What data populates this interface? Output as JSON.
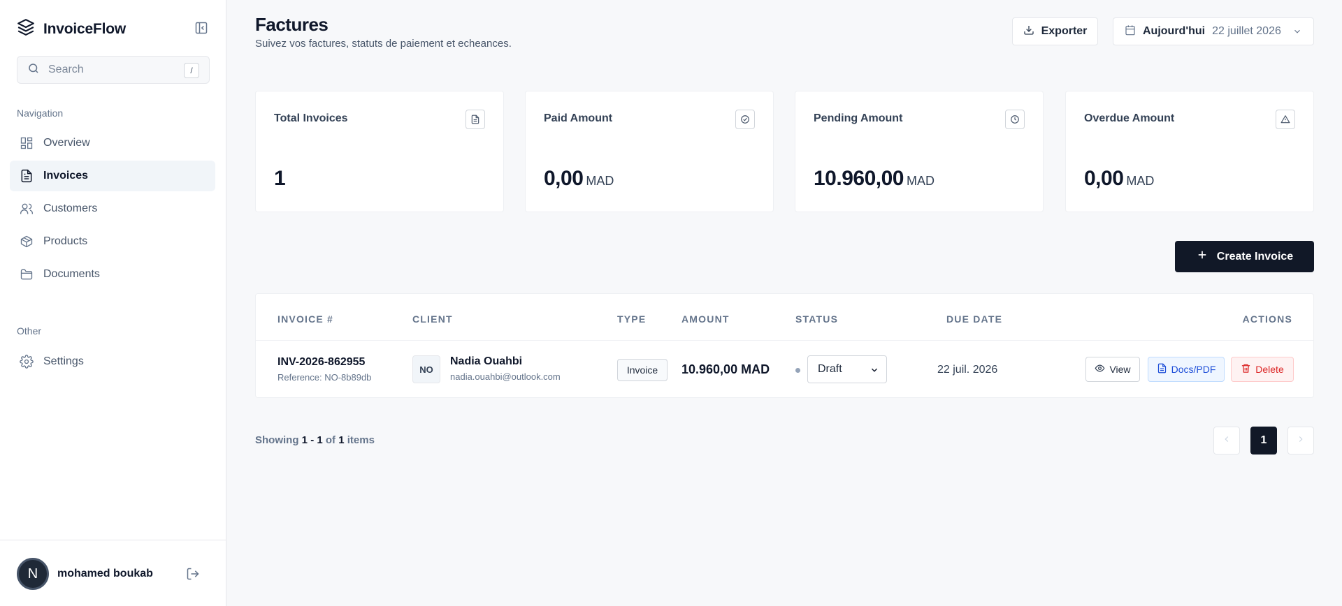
{
  "app": {
    "name": "InvoiceFlow"
  },
  "search": {
    "placeholder": "Search",
    "shortcut": "/"
  },
  "sidebar": {
    "nav_label": "Navigation",
    "items": [
      {
        "label": "Overview",
        "icon": "grid-icon"
      },
      {
        "label": "Invoices",
        "icon": "file-text-icon",
        "active": true
      },
      {
        "label": "Customers",
        "icon": "users-icon"
      },
      {
        "label": "Products",
        "icon": "package-icon"
      },
      {
        "label": "Documents",
        "icon": "folder-icon"
      }
    ],
    "other_label": "Other",
    "other_items": [
      {
        "label": "Settings",
        "icon": "gear-icon"
      }
    ]
  },
  "user": {
    "initial": "N",
    "name": "mohamed boukab"
  },
  "header": {
    "title": "Factures",
    "subtitle": "Suivez vos factures, statuts de paiement et echeances.",
    "export_label": "Exporter",
    "date_label": "Aujourd'hui",
    "date_value": "22 juillet 2026"
  },
  "stats": [
    {
      "title": "Total Invoices",
      "value": "1",
      "unit": "",
      "icon": "file-icon"
    },
    {
      "title": "Paid Amount",
      "value": "0,00",
      "unit": "MAD",
      "icon": "check-circle-icon"
    },
    {
      "title": "Pending Amount",
      "value": "10.960,00",
      "unit": "MAD",
      "icon": "clock-icon"
    },
    {
      "title": "Overdue Amount",
      "value": "0,00",
      "unit": "MAD",
      "icon": "alert-triangle-icon"
    }
  ],
  "create_label": "Create Invoice",
  "table": {
    "headers": {
      "invoice": "INVOICE #",
      "client": "CLIENT",
      "type": "TYPE",
      "amount": "AMOUNT",
      "status": "STATUS",
      "due": "DUE DATE",
      "actions": "ACTIONS"
    },
    "rows": [
      {
        "number": "INV-2026-862955",
        "reference": "Reference: NO-8b89db",
        "initials": "NO",
        "client_name": "Nadia Ouahbi",
        "client_email": "nadia.ouahbi@outlook.com",
        "type": "Invoice",
        "amount": "10.960,00 MAD",
        "status": "Draft",
        "due_date": "22 juil. 2026",
        "actions": {
          "view": "View",
          "docs": "Docs/PDF",
          "delete": "Delete"
        }
      }
    ]
  },
  "pagination": {
    "showing": "Showing",
    "from": "1",
    "sep": "-",
    "to": "1",
    "of": "of",
    "total": "1",
    "items": "items",
    "current": "1"
  },
  "colors": {
    "primary": "#111827",
    "danger": "#dc2626",
    "info": "#1d4ed8",
    "muted": "#64748b"
  }
}
